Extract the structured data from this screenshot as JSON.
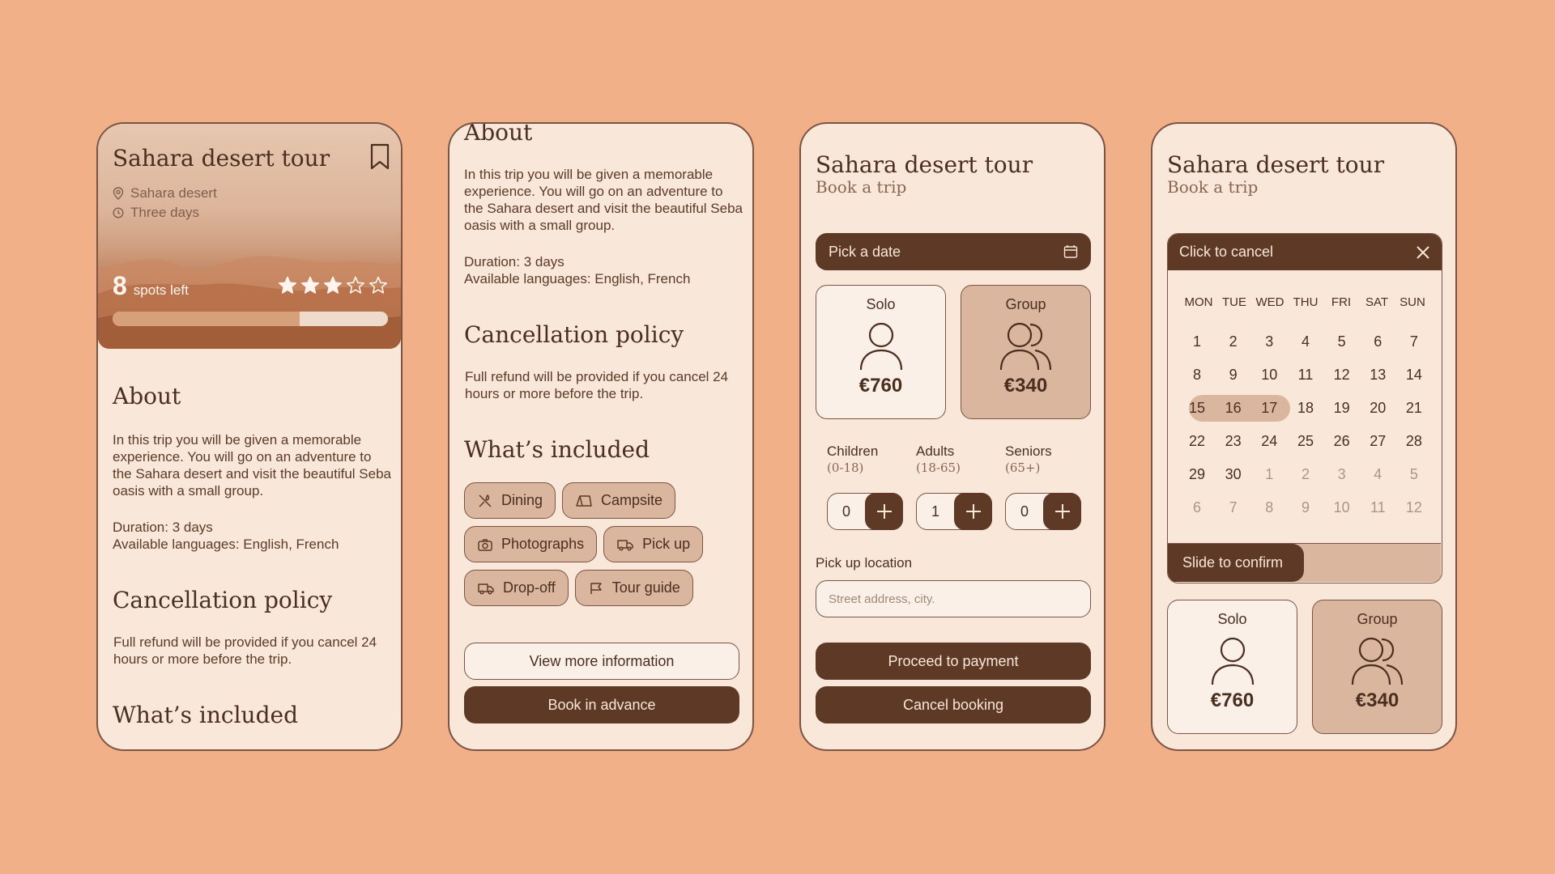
{
  "colors": {
    "background": "#f2b088",
    "card": "#f9e7da",
    "dark": "#5e3925",
    "chip": "#dbb69e",
    "text": "#4a2e1f"
  },
  "tour": {
    "title": "Sahara desert tour",
    "location": "Sahara desert",
    "duration_short": "Three days",
    "spots_count": "8",
    "spots_label": "spots left",
    "rating": 3,
    "rating_max": 5,
    "spots_fill_fraction": 0.68
  },
  "about": {
    "title": "About",
    "text": "In this trip you will be given a memorable experience. You will go on an adventure to the Sahara desert and visit the beautiful Seba oasis with a small group.",
    "duration": "Duration: 3 days",
    "languages": "Available languages: English, French"
  },
  "cancellation": {
    "title": "Cancellation policy",
    "text": "Full refund will be provided if you cancel 24 hours or more before the trip."
  },
  "included": {
    "title": "What’s included",
    "items": [
      {
        "label": "Dining",
        "icon": "utensils-icon"
      },
      {
        "label": "Campsite",
        "icon": "tent-icon"
      },
      {
        "label": "Photographs",
        "icon": "camera-icon"
      },
      {
        "label": "Pick up",
        "icon": "truck-icon"
      },
      {
        "label": "Drop-off",
        "icon": "truck-icon"
      },
      {
        "label": "Tour guide",
        "icon": "flag-icon"
      }
    ]
  },
  "actions": {
    "view_more": "View more information",
    "book_advance": "Book in advance",
    "proceed": "Proceed to payment",
    "cancel": "Cancel booking"
  },
  "booking": {
    "subtitle": "Book a trip",
    "pick_date": "Pick a date",
    "solo_label": "Solo",
    "solo_price": "€760",
    "group_label": "Group",
    "group_price": "€340",
    "groups": [
      {
        "label": "Children",
        "range": "(0-18)",
        "value": "0"
      },
      {
        "label": "Adults",
        "range": "(18-65)",
        "value": "1"
      },
      {
        "label": "Seniors",
        "range": "(65+)",
        "value": "0"
      }
    ],
    "pickup_label": "Pick up location",
    "pickup_placeholder": "Street address, city."
  },
  "calendar": {
    "header": "Click to cancel",
    "days": [
      "MON",
      "TUE",
      "WED",
      "THU",
      "FRI",
      "SAT",
      "SUN"
    ],
    "weeks": [
      [
        "1",
        "2",
        "3",
        "4",
        "5",
        "6",
        "7"
      ],
      [
        "8",
        "9",
        "10",
        "11",
        "12",
        "13",
        "14"
      ],
      [
        "15",
        "16",
        "17",
        "18",
        "19",
        "20",
        "21"
      ],
      [
        "22",
        "23",
        "24",
        "25",
        "26",
        "27",
        "28"
      ],
      [
        "29",
        "30",
        "1",
        "2",
        "3",
        "4",
        "5"
      ],
      [
        "6",
        "7",
        "8",
        "9",
        "10",
        "11",
        "12"
      ]
    ],
    "selected_range": [
      "15",
      "17"
    ],
    "slide_label": "Slide to confirm"
  }
}
